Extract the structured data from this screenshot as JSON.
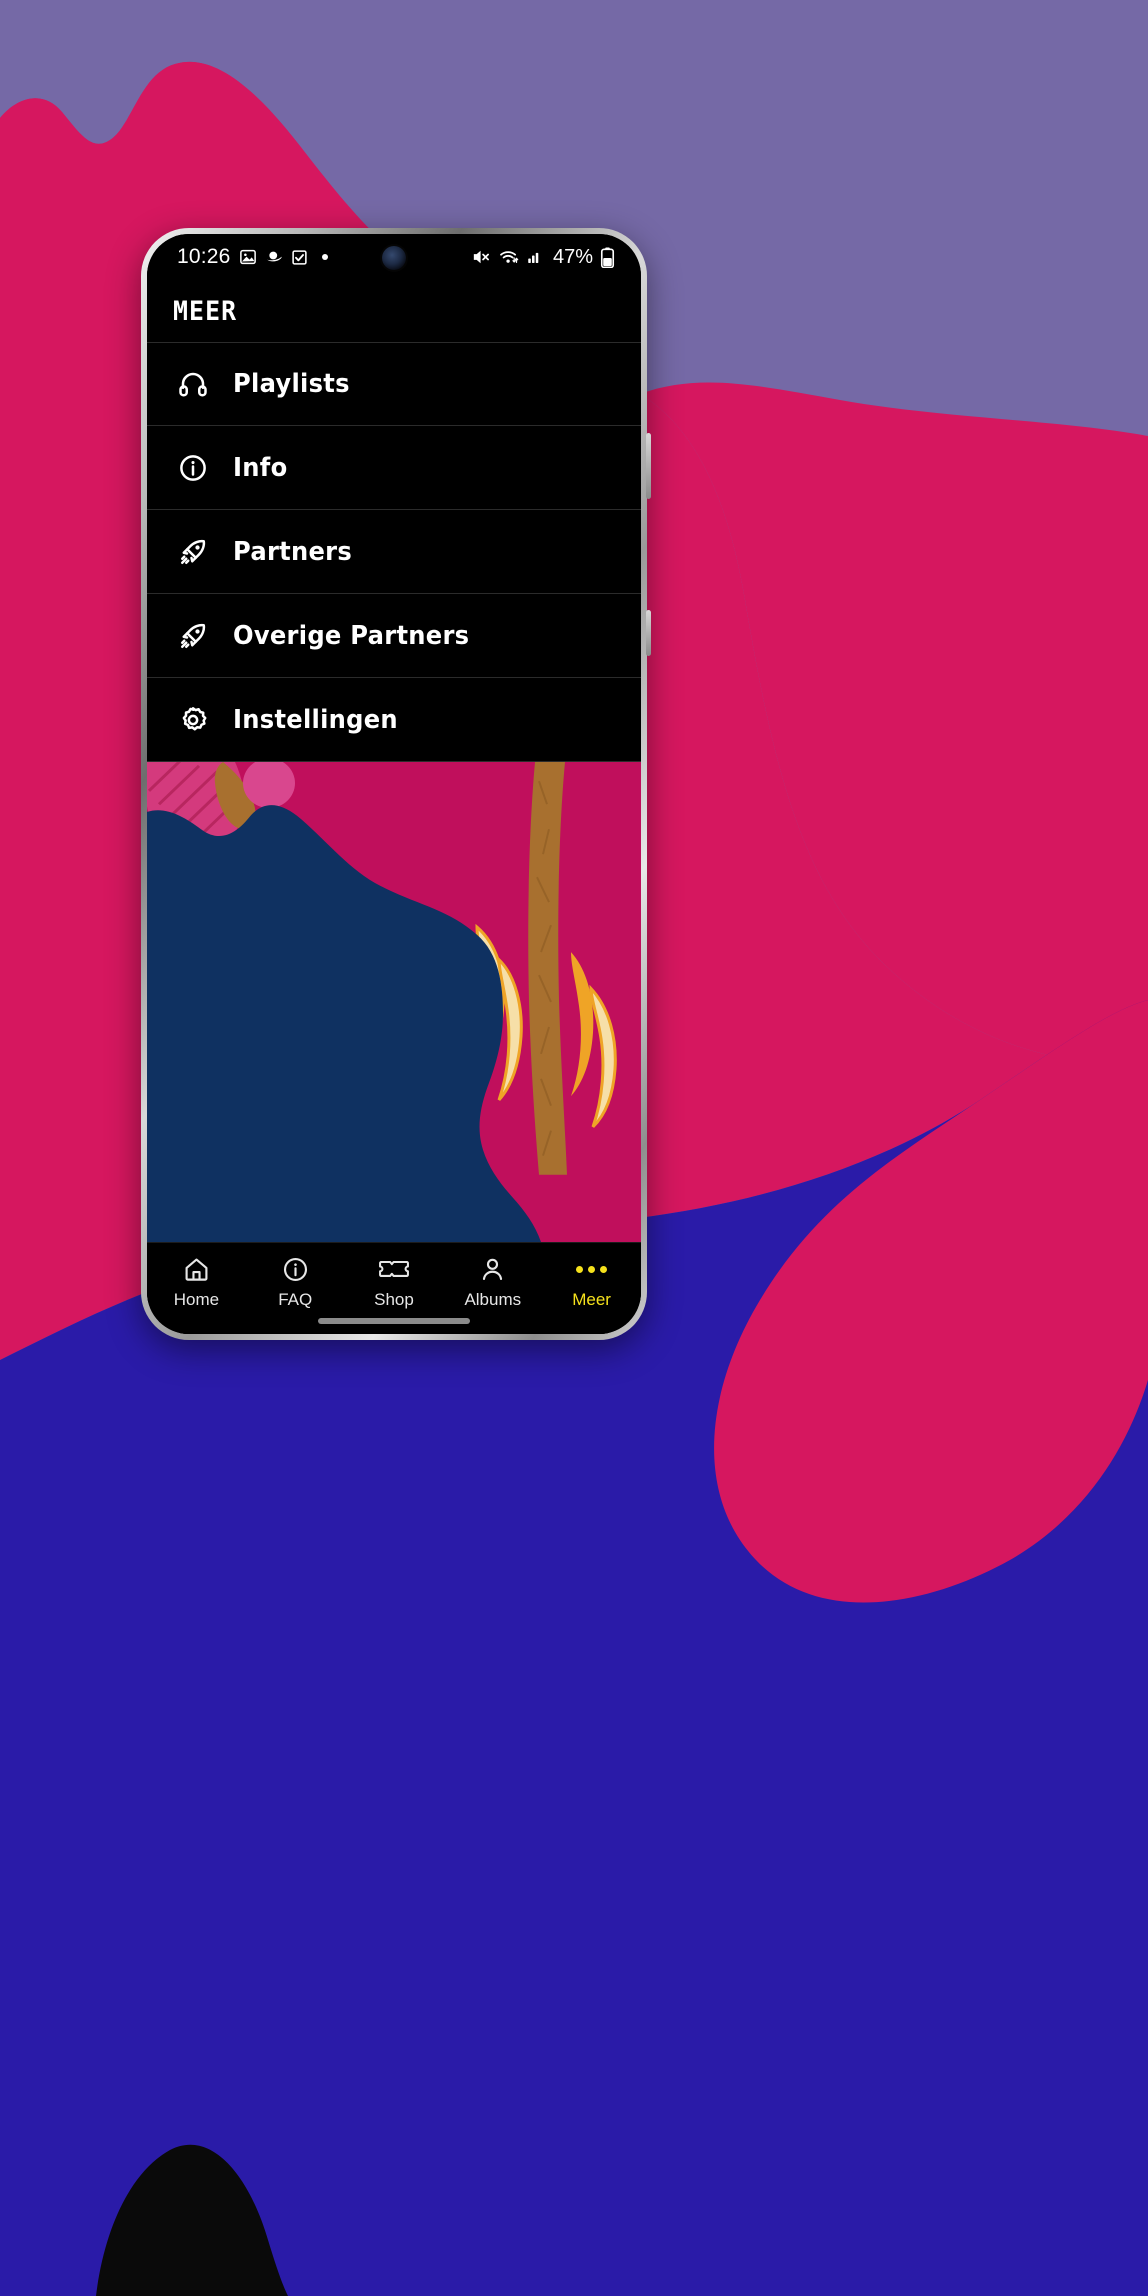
{
  "wallpaper": {
    "purple": "#7569a6",
    "pink": "#d6175f",
    "blue": "#2a1ba8",
    "black": "#0a0a0a"
  },
  "status_bar": {
    "time": "10:26",
    "left_icons": [
      "photo-icon",
      "saturn-icon",
      "checkbox-icon",
      "dot-indicator"
    ],
    "right_icons": [
      "mute-icon",
      "wifi-icon",
      "cellular-signal-icon"
    ],
    "battery_percent": "47%",
    "battery_icon": "battery-icon"
  },
  "app": {
    "title": "MEER"
  },
  "menu": {
    "items": [
      {
        "label": "Playlists",
        "icon": "headphones-icon"
      },
      {
        "label": "Info",
        "icon": "info-circle-icon"
      },
      {
        "label": "Partners",
        "icon": "rocket-icon"
      },
      {
        "label": "Overige Partners",
        "icon": "rocket-icon"
      },
      {
        "label": "Instellingen",
        "icon": "gear-icon"
      }
    ]
  },
  "hero": {
    "colors": {
      "magenta": "#c00f5c",
      "navy": "#0f3161",
      "bread": "#a8702f",
      "banana": "#f6dfa8",
      "banana_shadow": "#efa426",
      "pink_stripe": "#d43a7d"
    }
  },
  "bottom_nav": {
    "items": [
      {
        "label": "Home",
        "icon": "home-icon",
        "active": false
      },
      {
        "label": "FAQ",
        "icon": "info-circle-icon",
        "active": false
      },
      {
        "label": "Shop",
        "icon": "ticket-icon",
        "active": false
      },
      {
        "label": "Albums",
        "icon": "person-icon",
        "active": false
      },
      {
        "label": "Meer",
        "icon": "ellipsis-icon",
        "active": true
      }
    ],
    "active_color": "#f5e11c"
  }
}
